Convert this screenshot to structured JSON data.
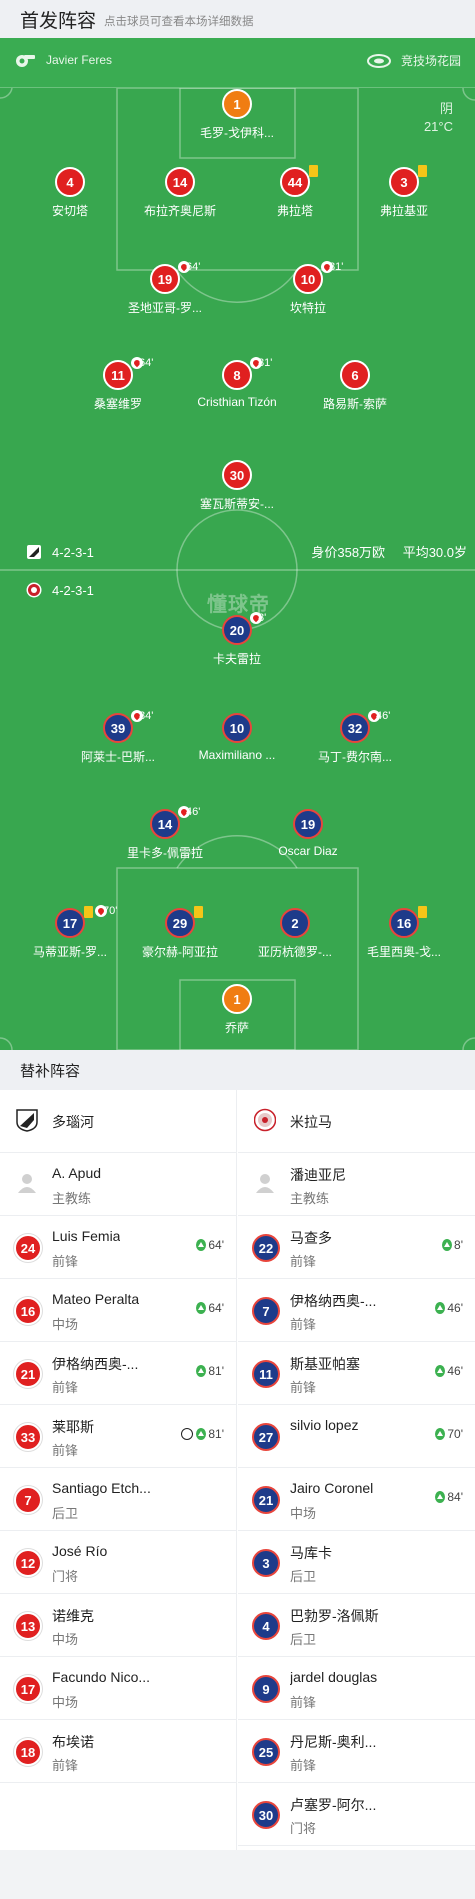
{
  "header": {
    "title": "首发阵容",
    "subtitle": "点击球员可查看本场详细数据"
  },
  "pitch": {
    "referee": "Javier Feres",
    "venue": "竞技场花园",
    "weather": {
      "condition": "阴",
      "temp": "21°C"
    },
    "watermark": "懂球帝",
    "home_formation": "4-2-3-1",
    "away_formation": "4-2-3-1",
    "stats": {
      "value": "身价358万欧",
      "age": "平均30.0岁"
    },
    "home_players": [
      {
        "num": "1",
        "name": "毛罗-戈伊科...",
        "color": "orange"
      },
      {
        "num": "4",
        "name": "安切塔",
        "color": "red"
      },
      {
        "num": "14",
        "name": "布拉齐奥尼斯",
        "color": "red"
      },
      {
        "num": "44",
        "name": "弗拉塔",
        "color": "red",
        "yellow": true
      },
      {
        "num": "3",
        "name": "弗拉基亚",
        "color": "red",
        "yellow": true
      },
      {
        "num": "19",
        "name": "圣地亚哥-罗...",
        "color": "red",
        "sub_min": "64'"
      },
      {
        "num": "10",
        "name": "坎特拉",
        "color": "red",
        "sub_min": "81'"
      },
      {
        "num": "11",
        "name": "桑塞维罗",
        "color": "red",
        "sub_min": "64'"
      },
      {
        "num": "8",
        "name": "Cristhian Tizón",
        "color": "red",
        "sub_min": "81'"
      },
      {
        "num": "6",
        "name": "路易斯-索萨",
        "color": "red"
      },
      {
        "num": "30",
        "name": "塞瓦斯蒂安-...",
        "color": "red"
      }
    ],
    "away_players": [
      {
        "num": "20",
        "name": "卡夫雷拉",
        "color": "blue",
        "sub_min": "8'"
      },
      {
        "num": "39",
        "name": "阿莱士-巴斯...",
        "color": "blue",
        "sub_min": "84'"
      },
      {
        "num": "10",
        "name": "Maximiliano ...",
        "color": "blue"
      },
      {
        "num": "32",
        "name": "马丁-费尔南...",
        "color": "blue",
        "sub_min": "46'"
      },
      {
        "num": "14",
        "name": "里卡多-佩雷拉",
        "color": "blue",
        "sub_min": "46'"
      },
      {
        "num": "19",
        "name": "Oscar Diaz",
        "color": "blue"
      },
      {
        "num": "17",
        "name": "马蒂亚斯-罗...",
        "color": "blue",
        "yellow": true,
        "sub_min": "70'"
      },
      {
        "num": "29",
        "name": "豪尔赫-阿亚拉",
        "color": "blue",
        "yellow": true
      },
      {
        "num": "2",
        "name": "亚历杭德罗-...",
        "color": "blue"
      },
      {
        "num": "16",
        "name": "毛里西奥-戈...",
        "color": "blue",
        "yellow": true
      },
      {
        "num": "1",
        "name": "乔萨",
        "color": "orange"
      }
    ]
  },
  "subs_header": "替补阵容",
  "home": {
    "team": "多瑙河",
    "coach": {
      "name": "A. Apud",
      "role": "主教练"
    },
    "subs": [
      {
        "num": "24",
        "name": "Luis Femia",
        "pos": "前锋",
        "min": "64'",
        "in": true
      },
      {
        "num": "16",
        "name": "Mateo Peralta",
        "pos": "中场",
        "min": "64'",
        "in": true
      },
      {
        "num": "21",
        "name": "伊格纳西奥-...",
        "pos": "前锋",
        "min": "81'",
        "in": true
      },
      {
        "num": "33",
        "name": "莱耶斯",
        "pos": "前锋",
        "min": "81'",
        "in": true,
        "goal": true
      },
      {
        "num": "7",
        "name": "Santiago Etch...",
        "pos": "后卫"
      },
      {
        "num": "12",
        "name": "José Río",
        "pos": "门将"
      },
      {
        "num": "13",
        "name": "诺维克",
        "pos": "中场"
      },
      {
        "num": "17",
        "name": "Facundo Nico...",
        "pos": "中场"
      },
      {
        "num": "18",
        "name": "布埃诺",
        "pos": "前锋"
      }
    ]
  },
  "away": {
    "team": "米拉马",
    "coach": {
      "name": "潘迪亚尼",
      "role": "主教练"
    },
    "subs": [
      {
        "num": "22",
        "name": "马查多",
        "pos": "前锋",
        "min": "8'",
        "in": true
      },
      {
        "num": "7",
        "name": "伊格纳西奥-...",
        "pos": "前锋",
        "min": "46'",
        "in": true
      },
      {
        "num": "11",
        "name": "斯基亚帕塞",
        "pos": "前锋",
        "min": "46'",
        "in": true
      },
      {
        "num": "27",
        "name": "silvio lopez",
        "pos": "",
        "min": "70'",
        "in": true
      },
      {
        "num": "21",
        "name": "Jairo Coronel",
        "pos": "中场",
        "min": "84'",
        "in": true
      },
      {
        "num": "3",
        "name": "马库卡",
        "pos": "后卫"
      },
      {
        "num": "4",
        "name": "巴勃罗-洛佩斯",
        "pos": "后卫"
      },
      {
        "num": "9",
        "name": "jardel douglas",
        "pos": "前锋"
      },
      {
        "num": "25",
        "name": "丹尼斯-奥利...",
        "pos": "前锋"
      },
      {
        "num": "30",
        "name": "卢塞罗-阿尔...",
        "pos": "门将"
      }
    ]
  }
}
